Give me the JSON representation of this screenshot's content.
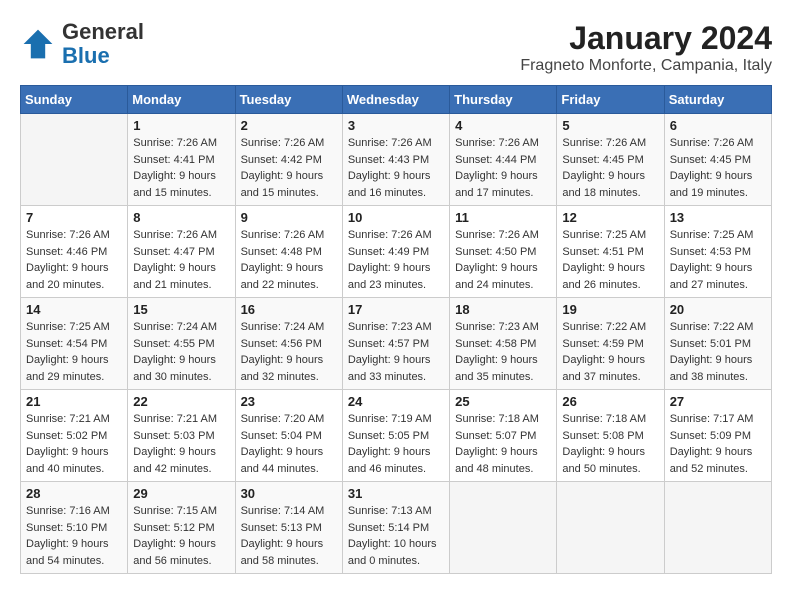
{
  "logo": {
    "general": "General",
    "blue": "Blue"
  },
  "title": "January 2024",
  "subtitle": "Fragneto Monforte, Campania, Italy",
  "days_header": [
    "Sunday",
    "Monday",
    "Tuesday",
    "Wednesday",
    "Thursday",
    "Friday",
    "Saturday"
  ],
  "weeks": [
    [
      {
        "day": "",
        "info": ""
      },
      {
        "day": "1",
        "info": "Sunrise: 7:26 AM\nSunset: 4:41 PM\nDaylight: 9 hours\nand 15 minutes."
      },
      {
        "day": "2",
        "info": "Sunrise: 7:26 AM\nSunset: 4:42 PM\nDaylight: 9 hours\nand 15 minutes."
      },
      {
        "day": "3",
        "info": "Sunrise: 7:26 AM\nSunset: 4:43 PM\nDaylight: 9 hours\nand 16 minutes."
      },
      {
        "day": "4",
        "info": "Sunrise: 7:26 AM\nSunset: 4:44 PM\nDaylight: 9 hours\nand 17 minutes."
      },
      {
        "day": "5",
        "info": "Sunrise: 7:26 AM\nSunset: 4:45 PM\nDaylight: 9 hours\nand 18 minutes."
      },
      {
        "day": "6",
        "info": "Sunrise: 7:26 AM\nSunset: 4:45 PM\nDaylight: 9 hours\nand 19 minutes."
      }
    ],
    [
      {
        "day": "7",
        "info": "Sunrise: 7:26 AM\nSunset: 4:46 PM\nDaylight: 9 hours\nand 20 minutes."
      },
      {
        "day": "8",
        "info": "Sunrise: 7:26 AM\nSunset: 4:47 PM\nDaylight: 9 hours\nand 21 minutes."
      },
      {
        "day": "9",
        "info": "Sunrise: 7:26 AM\nSunset: 4:48 PM\nDaylight: 9 hours\nand 22 minutes."
      },
      {
        "day": "10",
        "info": "Sunrise: 7:26 AM\nSunset: 4:49 PM\nDaylight: 9 hours\nand 23 minutes."
      },
      {
        "day": "11",
        "info": "Sunrise: 7:26 AM\nSunset: 4:50 PM\nDaylight: 9 hours\nand 24 minutes."
      },
      {
        "day": "12",
        "info": "Sunrise: 7:25 AM\nSunset: 4:51 PM\nDaylight: 9 hours\nand 26 minutes."
      },
      {
        "day": "13",
        "info": "Sunrise: 7:25 AM\nSunset: 4:53 PM\nDaylight: 9 hours\nand 27 minutes."
      }
    ],
    [
      {
        "day": "14",
        "info": "Sunrise: 7:25 AM\nSunset: 4:54 PM\nDaylight: 9 hours\nand 29 minutes."
      },
      {
        "day": "15",
        "info": "Sunrise: 7:24 AM\nSunset: 4:55 PM\nDaylight: 9 hours\nand 30 minutes."
      },
      {
        "day": "16",
        "info": "Sunrise: 7:24 AM\nSunset: 4:56 PM\nDaylight: 9 hours\nand 32 minutes."
      },
      {
        "day": "17",
        "info": "Sunrise: 7:23 AM\nSunset: 4:57 PM\nDaylight: 9 hours\nand 33 minutes."
      },
      {
        "day": "18",
        "info": "Sunrise: 7:23 AM\nSunset: 4:58 PM\nDaylight: 9 hours\nand 35 minutes."
      },
      {
        "day": "19",
        "info": "Sunrise: 7:22 AM\nSunset: 4:59 PM\nDaylight: 9 hours\nand 37 minutes."
      },
      {
        "day": "20",
        "info": "Sunrise: 7:22 AM\nSunset: 5:01 PM\nDaylight: 9 hours\nand 38 minutes."
      }
    ],
    [
      {
        "day": "21",
        "info": "Sunrise: 7:21 AM\nSunset: 5:02 PM\nDaylight: 9 hours\nand 40 minutes."
      },
      {
        "day": "22",
        "info": "Sunrise: 7:21 AM\nSunset: 5:03 PM\nDaylight: 9 hours\nand 42 minutes."
      },
      {
        "day": "23",
        "info": "Sunrise: 7:20 AM\nSunset: 5:04 PM\nDaylight: 9 hours\nand 44 minutes."
      },
      {
        "day": "24",
        "info": "Sunrise: 7:19 AM\nSunset: 5:05 PM\nDaylight: 9 hours\nand 46 minutes."
      },
      {
        "day": "25",
        "info": "Sunrise: 7:18 AM\nSunset: 5:07 PM\nDaylight: 9 hours\nand 48 minutes."
      },
      {
        "day": "26",
        "info": "Sunrise: 7:18 AM\nSunset: 5:08 PM\nDaylight: 9 hours\nand 50 minutes."
      },
      {
        "day": "27",
        "info": "Sunrise: 7:17 AM\nSunset: 5:09 PM\nDaylight: 9 hours\nand 52 minutes."
      }
    ],
    [
      {
        "day": "28",
        "info": "Sunrise: 7:16 AM\nSunset: 5:10 PM\nDaylight: 9 hours\nand 54 minutes."
      },
      {
        "day": "29",
        "info": "Sunrise: 7:15 AM\nSunset: 5:12 PM\nDaylight: 9 hours\nand 56 minutes."
      },
      {
        "day": "30",
        "info": "Sunrise: 7:14 AM\nSunset: 5:13 PM\nDaylight: 9 hours\nand 58 minutes."
      },
      {
        "day": "31",
        "info": "Sunrise: 7:13 AM\nSunset: 5:14 PM\nDaylight: 10 hours\nand 0 minutes."
      },
      {
        "day": "",
        "info": ""
      },
      {
        "day": "",
        "info": ""
      },
      {
        "day": "",
        "info": ""
      }
    ]
  ]
}
